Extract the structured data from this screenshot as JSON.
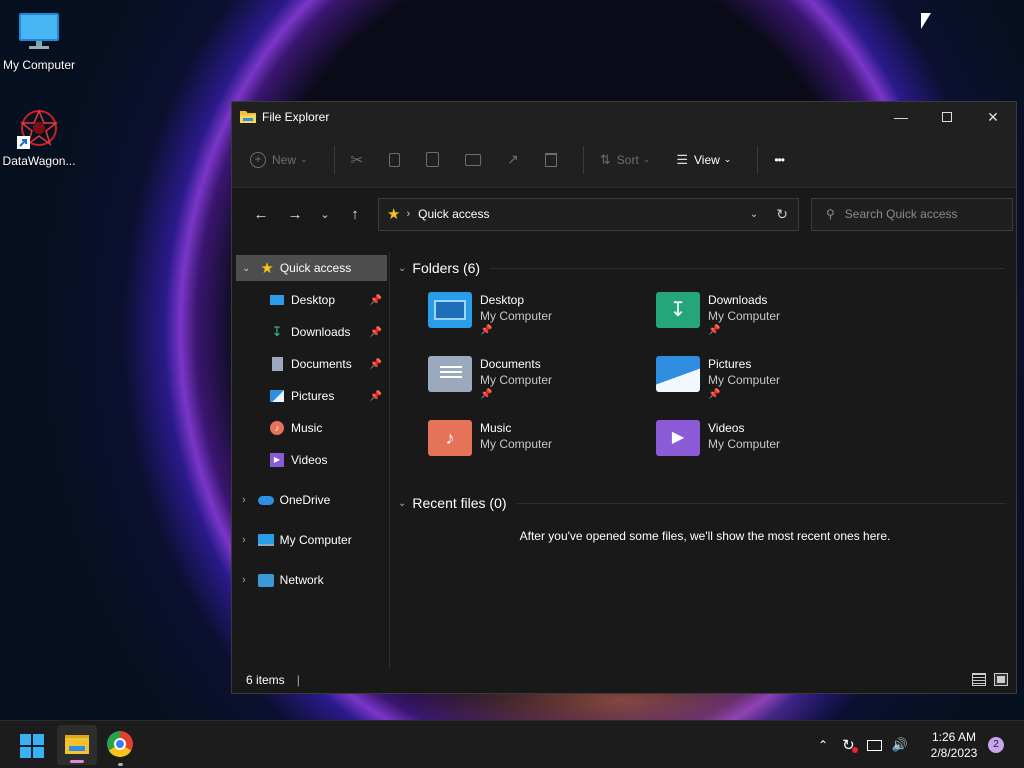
{
  "desktop": {
    "icons": [
      {
        "label": "My Computer",
        "icon": "monitor-icon"
      },
      {
        "label": "DataWagon...",
        "icon": "datawagon-shortcut-icon"
      }
    ]
  },
  "window": {
    "title": "File Explorer",
    "toolbar": {
      "new_label": "New",
      "sort_label": "Sort",
      "view_label": "View",
      "more_label": "•••"
    },
    "address": {
      "location": "Quick access"
    },
    "search": {
      "placeholder": "Search Quick access"
    },
    "sidebar": {
      "quick_access": "Quick access",
      "pinned": [
        {
          "label": "Desktop",
          "pinned": true
        },
        {
          "label": "Downloads",
          "pinned": true
        },
        {
          "label": "Documents",
          "pinned": true
        },
        {
          "label": "Pictures",
          "pinned": true
        },
        {
          "label": "Music",
          "pinned": false
        },
        {
          "label": "Videos",
          "pinned": false
        }
      ],
      "onedrive": "OneDrive",
      "my_computer": "My Computer",
      "network": "Network"
    },
    "folders": {
      "heading": "Folders (6)",
      "items": [
        {
          "name": "Desktop",
          "location": "My Computer",
          "color": "#2a9de8"
        },
        {
          "name": "Downloads",
          "location": "My Computer",
          "color": "#25a67a"
        },
        {
          "name": "Documents",
          "location": "My Computer",
          "color": "#9aa9bd"
        },
        {
          "name": "Pictures",
          "location": "My Computer",
          "color": "#2f8ee0"
        },
        {
          "name": "Music",
          "location": "My Computer",
          "color": "#e5735a"
        },
        {
          "name": "Videos",
          "location": "My Computer",
          "color": "#8b5bd8"
        }
      ]
    },
    "recent": {
      "heading": "Recent files (0)",
      "empty_message": "After you've opened some files, we'll show the most recent ones here."
    },
    "status": {
      "items_count": "6 items",
      "separator": "|"
    }
  },
  "taskbar": {
    "time": "1:26 AM",
    "date": "2/8/2023",
    "notifications": "2"
  }
}
